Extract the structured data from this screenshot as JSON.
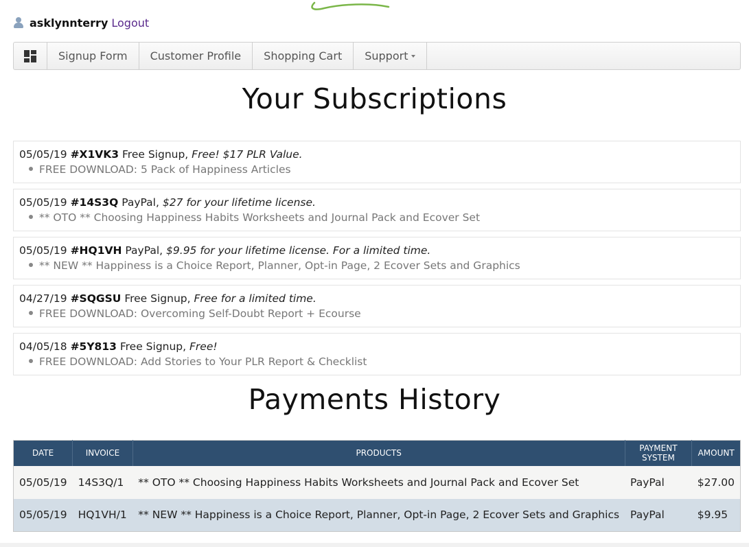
{
  "user": {
    "username": "asklynnterry",
    "logout_label": "Logout"
  },
  "nav": {
    "home_icon": "dashboard-grid-icon",
    "items": [
      {
        "label": "Signup Form"
      },
      {
        "label": "Customer Profile"
      },
      {
        "label": "Shopping Cart"
      },
      {
        "label": "Support"
      }
    ]
  },
  "subscriptions": {
    "title": "Your Subscriptions",
    "items": [
      {
        "date": "05/05/19",
        "code": "#X1VK3",
        "method": "Free Signup,",
        "terms": "Free! $17 PLR Value.",
        "product": "FREE DOWNLOAD: 5 Pack of Happiness Articles"
      },
      {
        "date": "05/05/19",
        "code": "#14S3Q",
        "method": "PayPal,",
        "terms": "$27 for your lifetime license.",
        "product": "** OTO ** Choosing Happiness Habits Worksheets and Journal Pack and Ecover Set"
      },
      {
        "date": "05/05/19",
        "code": "#HQ1VH",
        "method": "PayPal,",
        "terms": "$9.95 for your lifetime license. For a limited time.",
        "product": "** NEW ** Happiness is a Choice Report, Planner, Opt-in Page, 2 Ecover Sets and Graphics"
      },
      {
        "date": "04/27/19",
        "code": "#SQGSU",
        "method": "Free Signup,",
        "terms": "Free for a limited time.",
        "product": "FREE DOWNLOAD: Overcoming Self-Doubt Report + Ecourse"
      },
      {
        "date": "04/05/18",
        "code": "#5Y813",
        "method": "Free Signup,",
        "terms": "Free!",
        "product": "FREE DOWNLOAD: Add Stories to Your PLR Report & Checklist"
      }
    ]
  },
  "payments": {
    "title": "Payments History",
    "columns": [
      "DATE",
      "INVOICE",
      "PRODUCTS",
      "PAYMENT SYSTEM",
      "AMOUNT"
    ],
    "rows": [
      {
        "date": "05/05/19",
        "invoice": "14S3Q/1",
        "product": "** OTO ** Choosing Happiness Habits Worksheets and Journal Pack and Ecover Set",
        "system": "PayPal",
        "amount": "$27.00"
      },
      {
        "date": "05/05/19",
        "invoice": "HQ1VH/1",
        "product": "** NEW ** Happiness is a Choice Report, Planner, Opt-in Page, 2 Ecover Sets and Graphics",
        "system": "PayPal",
        "amount": "$9.95"
      }
    ]
  },
  "colors": {
    "table_header": "#2f4f70",
    "logout_link": "#5a2a8c",
    "logo_swoosh": "#7ab648"
  }
}
